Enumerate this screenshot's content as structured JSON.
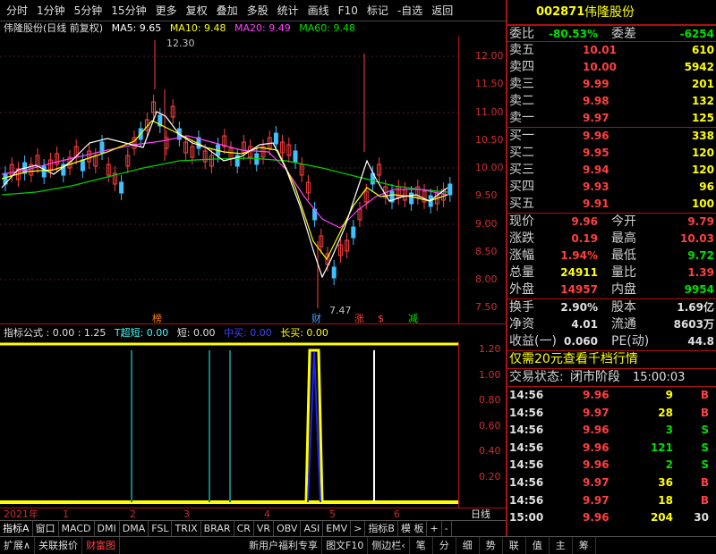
{
  "toolbar": {
    "items": [
      "分时",
      "1分钟",
      "5分钟",
      "15分钟",
      "更多",
      "复权",
      "叠加",
      "多股",
      "统计",
      "画线",
      "F10",
      "标记",
      "-自选",
      "返回"
    ]
  },
  "chart_header": {
    "title": "伟隆股份(日线 前复权)",
    "ma5": "MA5: 9.65",
    "ma10": "MA10: 9.48",
    "ma20": "MA20: 9.49",
    "ma60": "MA60: 9.48"
  },
  "price_axis": [
    "12.00",
    "11.50",
    "11.00",
    "10.50",
    "10.00",
    "9.50",
    "9.00",
    "8.50",
    "8.00",
    "7.50"
  ],
  "annotations": {
    "high": "12.30",
    "low": "7.47",
    "bang": "榜",
    "cai": "财",
    "zhang": "涨",
    "jian": "减",
    "mark": "$"
  },
  "indicator_header": {
    "label": "指标公式 : 0.00 : 1.25",
    "t1": "T超短: 0.00",
    "t2": "短: 0.00",
    "t3": "中买: 0.00",
    "t4": "长买: 0.00"
  },
  "ind_axis": [
    "1.20",
    "1.00",
    "0.80",
    "0.60",
    "0.40",
    "0.20"
  ],
  "time_axis": {
    "year": "2021年",
    "m1": "1",
    "m2": "2",
    "m3": "3",
    "m4": "4",
    "m5": "5",
    "m6": "6",
    "period": "日线"
  },
  "tabs_row1": [
    "指标A",
    "窗口",
    "MACD",
    "DMI",
    "DMA",
    "FSL",
    "TRIX",
    "BRAR",
    "CR",
    "VR",
    "OBV",
    "ASI",
    "EMV",
    ">",
    "指标B",
    "模 板",
    "+",
    "-"
  ],
  "tabs_row2": [
    "扩展∧",
    "关联报价",
    "财富图",
    "新用户福利专享",
    "图文F10",
    "侧边栏‹",
    "笔",
    "分",
    "细",
    "势",
    "联",
    "值",
    "主",
    "筹"
  ],
  "quote": {
    "code": "002871",
    "name": "伟隆股份",
    "weibi_label": "委比",
    "weibi": "-80.53%",
    "weicha_label": "委差",
    "weicha": "-6254",
    "sell": [
      {
        "label": "卖五",
        "price": "10.01",
        "vol": "610"
      },
      {
        "label": "卖四",
        "price": "10.00",
        "vol": "5942"
      },
      {
        "label": "卖三",
        "price": "9.99",
        "vol": "201"
      },
      {
        "label": "卖二",
        "price": "9.98",
        "vol": "132"
      },
      {
        "label": "卖一",
        "price": "9.97",
        "vol": "125"
      }
    ],
    "buy": [
      {
        "label": "买一",
        "price": "9.96",
        "vol": "338"
      },
      {
        "label": "买二",
        "price": "9.95",
        "vol": "120"
      },
      {
        "label": "买三",
        "price": "9.94",
        "vol": "120"
      },
      {
        "label": "买四",
        "price": "9.93",
        "vol": "96"
      },
      {
        "label": "买五",
        "price": "9.91",
        "vol": "100"
      }
    ],
    "stats": [
      {
        "l1": "现价",
        "v1": "9.96",
        "l2": "今开",
        "v2": "9.79"
      },
      {
        "l1": "涨跌",
        "v1": "0.19",
        "l2": "最高",
        "v2": "10.03"
      },
      {
        "l1": "涨幅",
        "v1": "1.94%",
        "l2": "最低",
        "v2": "9.72"
      },
      {
        "l1": "总量",
        "v1": "24911",
        "l2": "量比",
        "v2": "1.39"
      },
      {
        "l1": "外盘",
        "v1": "14957",
        "l2": "内盘",
        "v2": "9954"
      }
    ],
    "stats2": [
      {
        "l1": "换手",
        "v1": "2.90%",
        "l2": "股本",
        "v2": "1.69亿"
      },
      {
        "l1": "净资",
        "v1": "4.01",
        "l2": "流通",
        "v2": "8603万"
      },
      {
        "l1": "收益(一)",
        "v1": "0.060",
        "l2": "PE(动)",
        "v2": "44.8"
      }
    ],
    "promo": "仅需20元查看千档行情",
    "status_label": "交易状态:",
    "status": "闭市阶段",
    "status_time": "15:00:03",
    "ticks": [
      {
        "t": "14:56",
        "p": "9.96",
        "v": "9",
        "d": "B"
      },
      {
        "t": "14:56",
        "p": "9.97",
        "v": "28",
        "d": "B"
      },
      {
        "t": "14:56",
        "p": "9.96",
        "v": "3",
        "d": "S"
      },
      {
        "t": "14:56",
        "p": "9.96",
        "v": "121",
        "d": "S"
      },
      {
        "t": "14:56",
        "p": "9.96",
        "v": "2",
        "d": "S"
      },
      {
        "t": "14:56",
        "p": "9.97",
        "v": "36",
        "d": "B"
      },
      {
        "t": "14:56",
        "p": "9.97",
        "v": "18",
        "d": "B"
      },
      {
        "t": "15:00",
        "p": "9.96",
        "v": "204",
        "d": "30"
      }
    ]
  }
}
